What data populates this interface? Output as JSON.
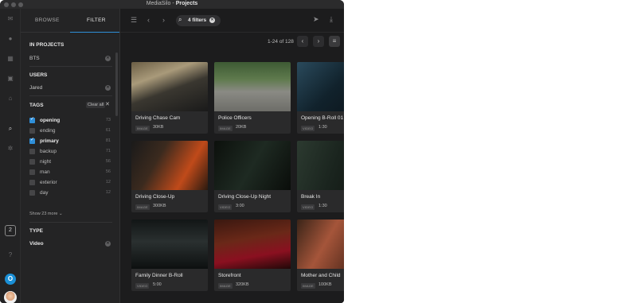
{
  "window": {
    "app_name": "MediaSilo",
    "separator": "-",
    "page": "Projects"
  },
  "rail": {
    "icons": [
      "inbox-icon",
      "globe-icon",
      "calendar-icon",
      "box-icon",
      "home-icon",
      "search-icon",
      "gear-icon"
    ],
    "badge": "2",
    "logo_letter": "O"
  },
  "panel": {
    "tabs": [
      {
        "label": "BROWSE"
      },
      {
        "label": "FILTER"
      }
    ],
    "in_projects": {
      "label": "IN PROJECTS",
      "value": "BTS"
    },
    "users": {
      "label": "USERS",
      "value": "Jared"
    },
    "tags": {
      "label": "TAGS",
      "clear_all": "Clear all",
      "items": [
        {
          "name": "opening",
          "count": "73",
          "checked": true
        },
        {
          "name": "ending",
          "count": "61",
          "checked": false
        },
        {
          "name": "primary",
          "count": "81",
          "checked": true
        },
        {
          "name": "backup",
          "count": "71",
          "checked": false
        },
        {
          "name": "night",
          "count": "56",
          "checked": false
        },
        {
          "name": "man",
          "count": "56",
          "checked": false
        },
        {
          "name": "exterior",
          "count": "12",
          "checked": false
        },
        {
          "name": "day",
          "count": "12",
          "checked": false
        }
      ],
      "show_more": "Show 23 more"
    },
    "type": {
      "label": "TYPE",
      "value": "Video"
    }
  },
  "toolbar": {
    "filters_label": "4 filters"
  },
  "pagination": {
    "range": "1-24 of 128"
  },
  "cards": [
    {
      "name": "Driving Chase Cam",
      "type": "IMAGE",
      "meta": "30KB",
      "thumb": "linear-gradient(160deg,#6b5e45 0%,#a99a7a 30%,#3a3730 55%,#1a1a1a 100%)"
    },
    {
      "name": "Police Officers",
      "type": "IMAGE",
      "meta": "20KB",
      "thumb": "linear-gradient(180deg,#3d5a34 0%,#5f7a4d 35%,#8a8a84 60%,#6d6d68 100%)"
    },
    {
      "name": "Opening B-Roll 01",
      "type": "VIDEO",
      "meta": "1:30",
      "thumb": "linear-gradient(135deg,#2a4a5c 0%,#11222c 50%,#0b1318 100%)"
    },
    {
      "name": "Driving Close-Up",
      "type": "IMAGE",
      "meta": "300KB",
      "thumb": "linear-gradient(120deg,#1a1a1a 0%,#3b2a1e 35%,#c04a1a 70%,#2a1a10 100%)"
    },
    {
      "name": "Driving Close-Up Night",
      "type": "VIDEO",
      "meta": "3:00",
      "thumb": "linear-gradient(120deg,#0c100c 0%,#1e2a22 50%,#0a0d0a 100%)"
    },
    {
      "name": "Break In",
      "type": "VIDEO",
      "meta": "1:30",
      "thumb": "linear-gradient(110deg,#2c3a30 0%,#1a241e 50%,#0e130f 100%)"
    },
    {
      "name": "Family Dinner B-Roll",
      "type": "VIDEO",
      "meta": "5:00",
      "thumb": "linear-gradient(180deg,#121616 0%,#2a3030 45%,#0d1010 100%)"
    },
    {
      "name": "Storefront",
      "type": "IMAGE",
      "meta": "320KB",
      "thumb": "linear-gradient(170deg,#3a1810 0%,#6a2818 40%,#8a1020 70%,#200808 100%)"
    },
    {
      "name": "Mother and Child",
      "type": "IMAGE",
      "meta": "100KB",
      "thumb": "linear-gradient(120deg,#3a2418 0%,#a5553a 40%,#2a140c 100%)"
    }
  ]
}
